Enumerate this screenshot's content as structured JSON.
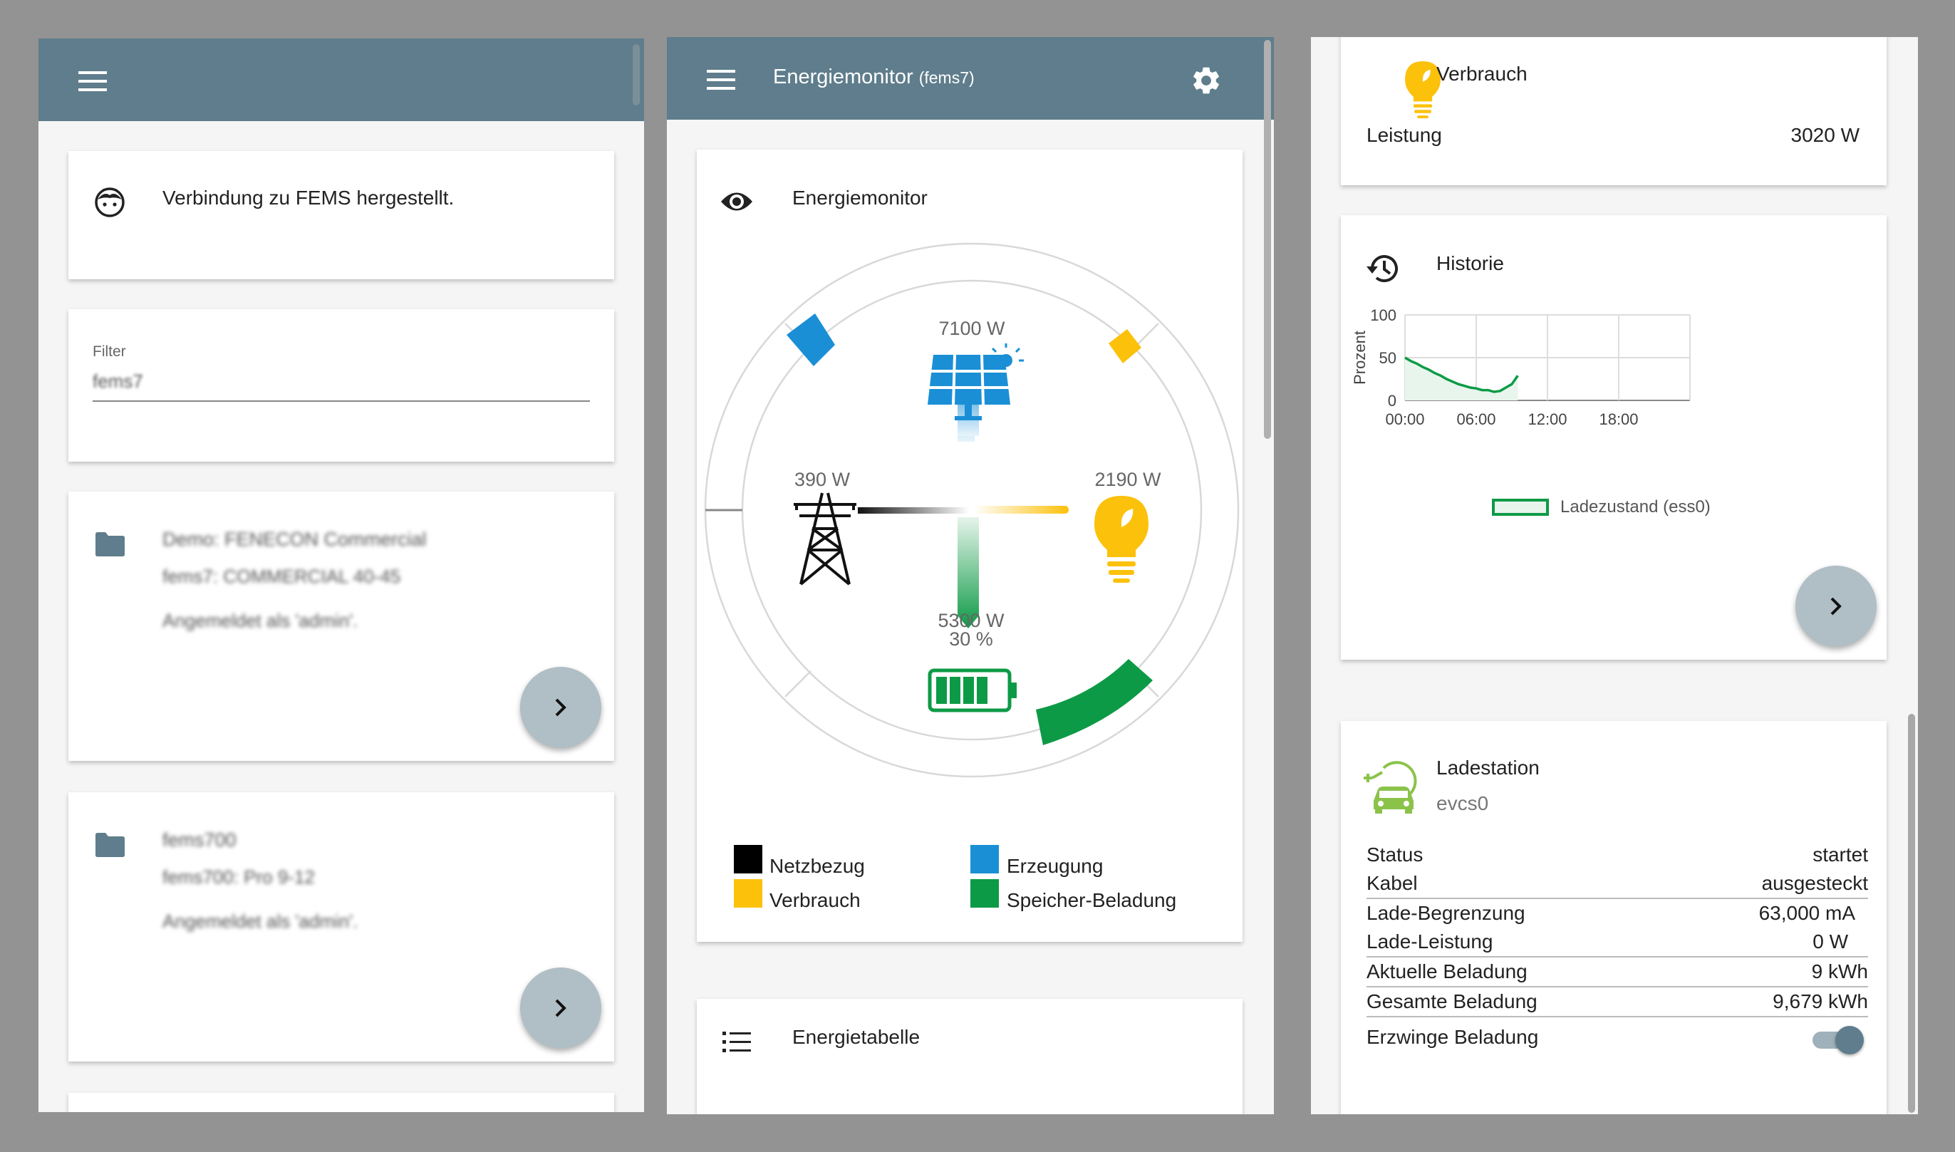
{
  "left": {
    "connection_text": "Verbindung zu FEMS hergestellt.",
    "filter_label": "Filter",
    "filter_value": "fems7",
    "devices": [
      {
        "title": "Demo: FENECON Commercial",
        "subtitle": "fems7: COMMERCIAL 40-45",
        "role": "Angemeldet als 'admin'."
      },
      {
        "title": "fems700",
        "subtitle": "fems700: Pro 9-12",
        "role": "Angemeldet als 'admin'."
      }
    ]
  },
  "middle": {
    "header_title": "Energiemonitor",
    "header_subtitle": "(fems7)",
    "monitor_title": "Energiemonitor",
    "production_value": "7100 W",
    "grid_value": "390 W",
    "consumption_value": "2190 W",
    "storage_value": "5300 W",
    "storage_soc": "30 %",
    "legend": [
      {
        "label": "Netzbezug",
        "color": "#000000"
      },
      {
        "label": "Erzeugung",
        "color": "#1a8fd6"
      },
      {
        "label": "Verbrauch",
        "color": "#fcc10b"
      },
      {
        "label": "Speicher-Beladung",
        "color": "#0d9a46"
      }
    ],
    "table_title": "Energietabelle"
  },
  "right": {
    "consumption": {
      "title": "Verbrauch",
      "label": "Leistung",
      "value": "3020 W"
    },
    "history": {
      "title": "Historie",
      "ylabel": "Prozent",
      "legend": "Ladezustand (ess0)"
    },
    "evcs": {
      "title": "Ladestation",
      "subtitle": "evcs0",
      "rows": [
        {
          "label": "Status",
          "value": "startet"
        },
        {
          "label": "Kabel",
          "value": "ausgesteckt"
        },
        {
          "label": "Lade-Begrenzung",
          "value": "63,000 mA"
        },
        {
          "label": "Lade-Leistung",
          "value": "0 W"
        },
        {
          "label": "Aktuelle Beladung",
          "value": "9 kWh"
        },
        {
          "label": "Gesamte Beladung",
          "value": "9,679 kWh"
        }
      ],
      "force_label": "Erzwinge Beladung",
      "force_on": true
    }
  },
  "chart_data": {
    "type": "area",
    "ylabel": "Prozent",
    "ylim": [
      0,
      100
    ],
    "yticks": [
      0,
      50,
      100
    ],
    "xticks": [
      "00:00",
      "06:00",
      "12:00",
      "18:00"
    ],
    "x": [
      "00:00",
      "00:30",
      "01:00",
      "01:30",
      "02:00",
      "02:30",
      "03:00",
      "03:30",
      "04:00",
      "04:30",
      "05:00",
      "05:30",
      "06:00",
      "06:30",
      "07:00",
      "07:30",
      "08:00",
      "08:30",
      "09:00",
      "09:30"
    ],
    "series": [
      {
        "name": "Ladezustand (ess0)",
        "values": [
          50,
          46,
          43,
          39,
          36,
          32,
          29,
          25,
          22,
          19,
          17,
          15,
          14,
          12,
          12,
          10,
          11,
          15,
          19,
          29
        ]
      }
    ],
    "legend": "bottom",
    "grid": true
  }
}
